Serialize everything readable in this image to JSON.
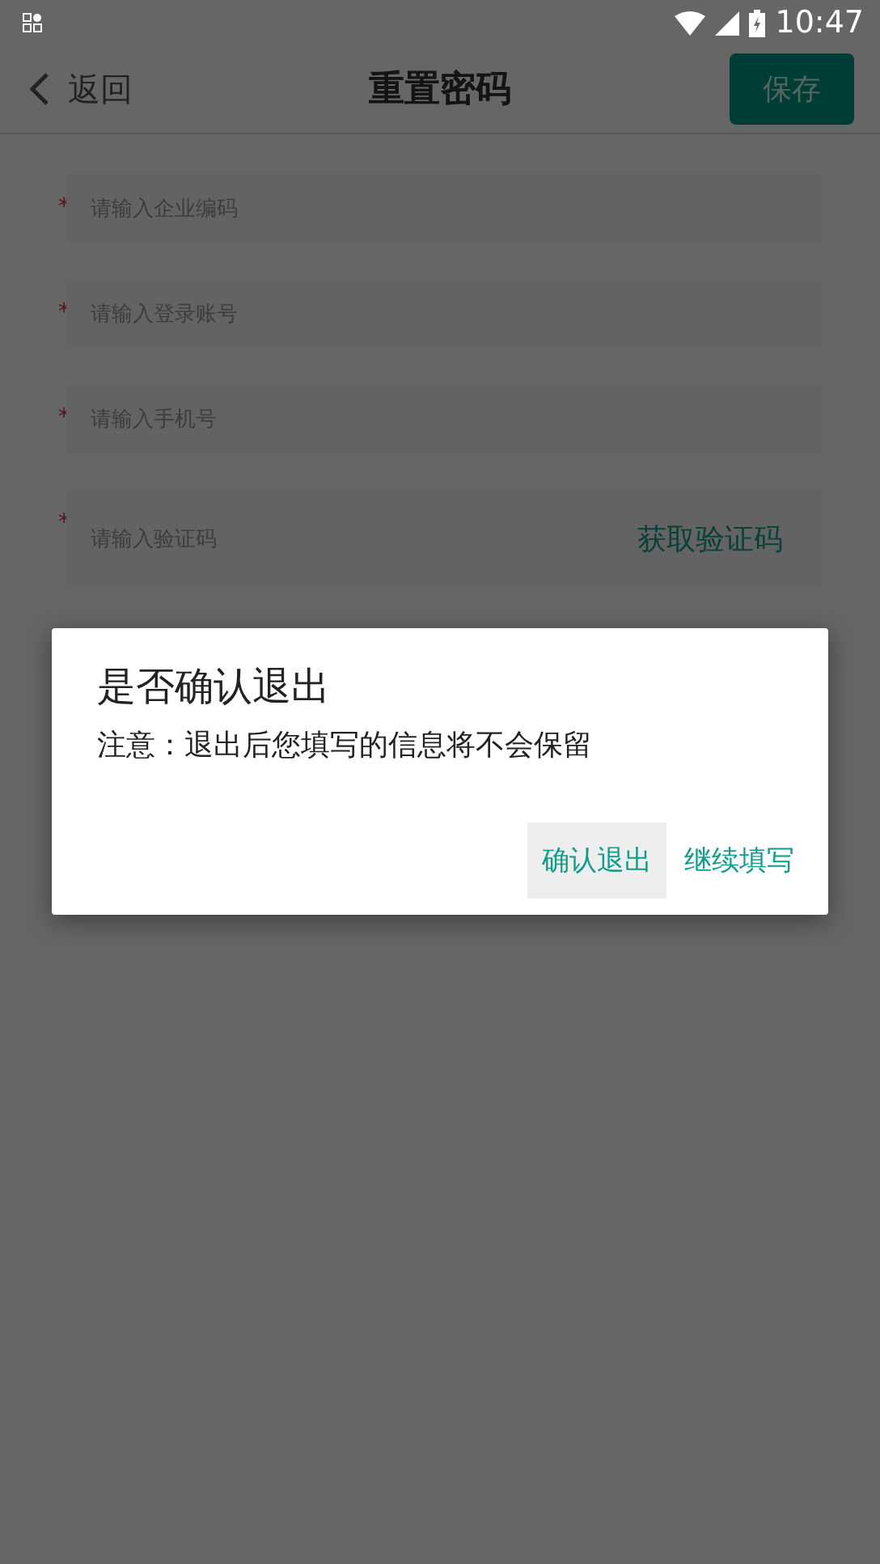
{
  "status_bar": {
    "time": "10:47"
  },
  "header": {
    "back_label": "返回",
    "title": "重置密码",
    "save_label": "保存"
  },
  "fields": [
    {
      "kind": "text",
      "required_mark": "*",
      "placeholder": "请输入企业编码"
    },
    {
      "kind": "text",
      "required_mark": "*",
      "placeholder": "请输入登录账号"
    },
    {
      "kind": "text",
      "required_mark": "*",
      "placeholder": "请输入手机号"
    },
    {
      "kind": "code",
      "required_mark": "*",
      "placeholder": "请输入验证码",
      "action": "获取验证码"
    }
  ],
  "dialog": {
    "title": "是否确认退出",
    "message": "注意：退出后您填写的信息将不会保留",
    "buttons": [
      {
        "label": "确认退出",
        "focused": true
      },
      {
        "label": "继续填写",
        "focused": false
      }
    ]
  }
}
